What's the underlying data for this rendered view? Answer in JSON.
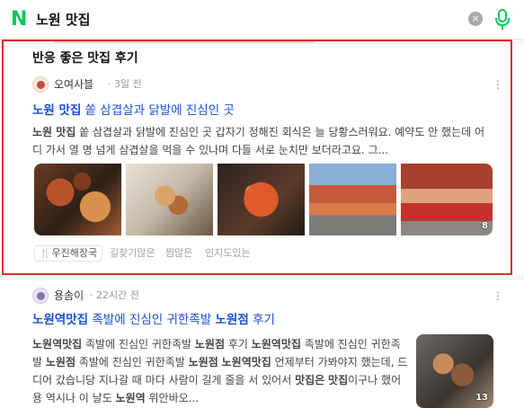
{
  "search": {
    "logo": "N",
    "query": "노원 맛집",
    "clear_icon": "×"
  },
  "card1": {
    "section_title": "반응 좋은 맛집 후기",
    "author": "오여사블",
    "time": "· 3일 전",
    "title_bold": "노원 맛집",
    "title_rest": " 쏱 삼겹살과 닭발에 진심인 곳",
    "snippet_bold": "노원 맛집",
    "snippet_rest": " 쏱 삼겹살과 닭발에 진심인 곳 갑자기 정해진 회식은 늘 당황스러워요. 예약도 안 했는데 어디 가서 열 명 넘게 삼겹살을 먹을 수 있나며 다들 서로 눈치만 보더라고요. 그...",
    "image_count": "8",
    "cafe_tag": "우진해장국",
    "keywords": [
      "길찾기많은",
      "찜많은",
      "인지도있는"
    ]
  },
  "card2": {
    "author": "용솜이",
    "time": "· 22시간 전",
    "title_bold1": "노원역맛집",
    "title_mid": " 족발에 진심인 귀한족발 ",
    "title_bold2": "노원점",
    "title_end": " 후기",
    "snippet_html_parts": {
      "line": "노원역맛집 족발에 진심인 귀한족발 노원점 후기 노원역맛집 족발에 진심인 귀한족발 노원점 족발에 진심인 귀한족발 노원점 노원역맛집 언제부터 가봐야지 했는데, 드디어 갔습니당 지나갈 때 마다 사람이 길게 줄을 서 있어서 맛집은 맛집이구나 했어용 역시나 이 날도 노원역 위안바오..."
    },
    "image_count": "13"
  },
  "colors": {
    "brand": "#03c75a",
    "link": "#1a4fd3",
    "highlight": "#e32a2a"
  }
}
